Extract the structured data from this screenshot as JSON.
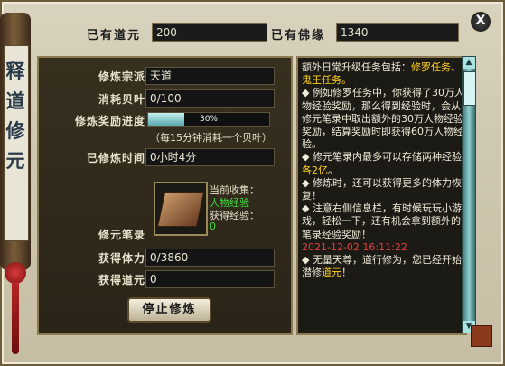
{
  "window": {
    "close_label": "X",
    "side_title": "释道修元"
  },
  "header": {
    "existing_dao_label": "已有道元",
    "existing_dao_value": "200",
    "existing_buddha_label": "已有佛缘",
    "existing_buddha_value": "1340"
  },
  "cultivation": {
    "sect_label": "修炼宗派",
    "sect_value": "天道",
    "shell_label": "消耗贝叶",
    "shell_value": "0/100",
    "progress_label": "修炼奖励进度",
    "progress_text": "30%",
    "progress_fraction": 0.3,
    "note": "（每15分钟消耗一个贝叶）",
    "time_label": "已修炼时间",
    "time_value": "0小时4分",
    "book_label": "修元笔录",
    "collect_title": "当前收集：",
    "collect_item": "人物经验",
    "gain_label": "获得经验：",
    "gain_value": "0",
    "stamina_label": "获得体力",
    "stamina_value": "0/3860",
    "dao_label": "获得道元",
    "dao_value": "0",
    "stop_button": "停止修炼"
  },
  "log": {
    "line1a": "额外日常升级任务包括：",
    "line1b": "修罗任务、鬼王任务。",
    "bullet2": "◆ 例如修罗任务中，你获得了30万人物经验奖励，那么得到经验时，会从修元笔录中取出额外的30万人物经验奖励，结算奖励时即获得60万人物经验。",
    "bullet3a": "◆ 修元笔录内最多可以存储两种经验",
    "bullet3b": "各2亿",
    "bullet3c": "。",
    "bullet4": "◆ 修炼时，还可以获得更多的体力恢复！",
    "bullet5": "◆ 注意右侧信息栏，有时候玩玩小游戏，轻松一下，还有机会拿到额外的笔录经验奖励！",
    "timestamp": "2021-12-02 16:11:22",
    "bullet6a": "◆ 无量天尊，道行修为，您已经开始潜修",
    "bullet6b": "道元",
    "bullet6c": "！"
  },
  "scrollbar": {
    "up": "▲",
    "down": "▼"
  },
  "colors": {
    "accent_gold": "#ffd21a",
    "timestamp_red": "#e04040",
    "green_text": "#3ddc3d",
    "progress_fill": "#5aa9b0"
  }
}
